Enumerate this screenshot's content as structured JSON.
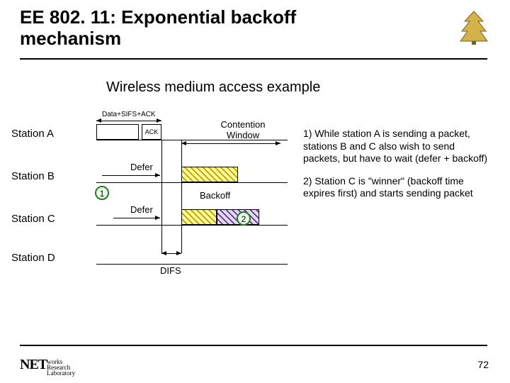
{
  "title": "EE 802. 11: Exponential backoff mechanism",
  "subtitle": "Wireless medium access example",
  "stations": {
    "a": "Station A",
    "b": "Station B",
    "c": "Station C",
    "d": "Station D"
  },
  "diagram": {
    "data_sifs_ack": "Data+SIFS+ACK",
    "ack": "ACK",
    "contention_window": "Contention Window",
    "defer_b": "Defer",
    "defer_c": "Defer",
    "backoff": "Backoff",
    "difs": "DIFS",
    "marker1": "1",
    "marker2": "2"
  },
  "notes": {
    "n1": "1) While station A is sending a packet, stations B and C also wish to send packets, but have to wait (defer + backoff)",
    "n2": "2) Station C is \"winner\" (backoff time expires first) and starts sending packet"
  },
  "page": "72",
  "logo": {
    "brand": "NET",
    "line1": "works",
    "line2": "esearch",
    "line3": "aboratory",
    "r": "R",
    "l": "L"
  }
}
